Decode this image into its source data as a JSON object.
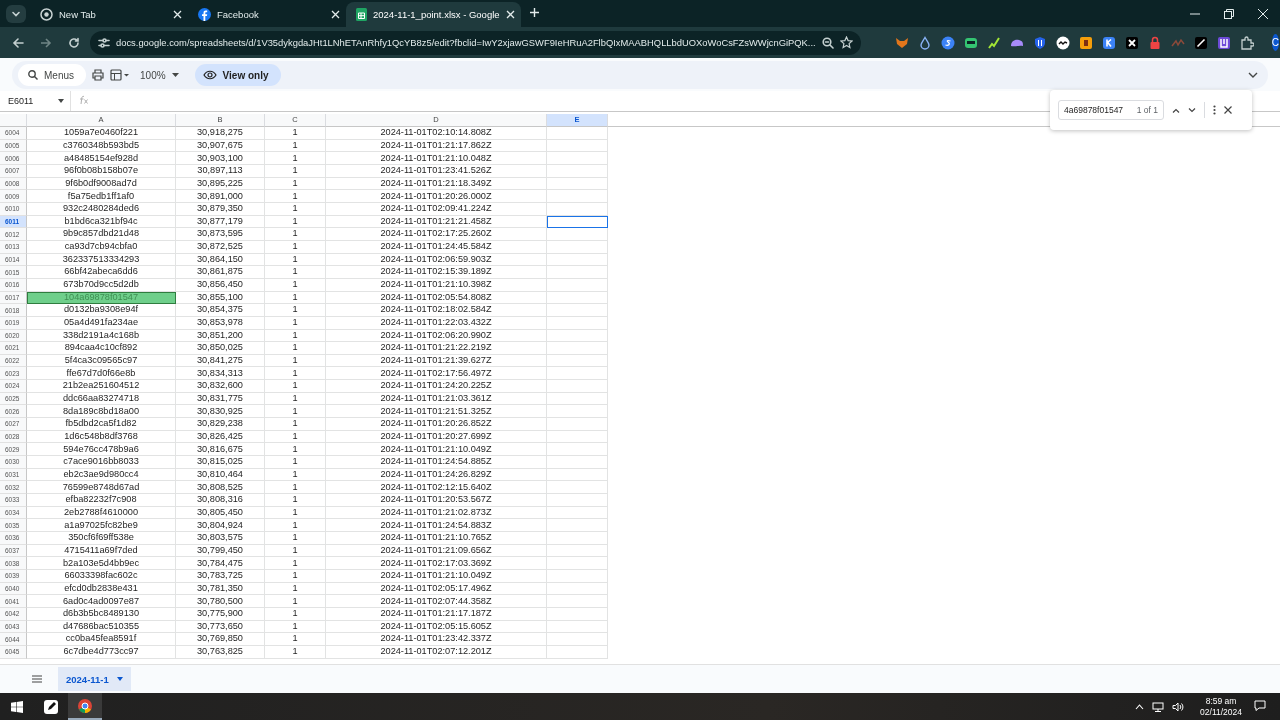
{
  "browser": {
    "tabs": [
      {
        "title": "New Tab",
        "kind": "chrome",
        "selected": false
      },
      {
        "title": "Facebook",
        "kind": "facebook",
        "selected": false
      },
      {
        "title": "2024-11-1_point.xlsx - Google",
        "kind": "sheets",
        "selected": true
      }
    ],
    "url": "docs.google.com/spreadsheets/d/1V35dykgdaJHt1LNhETAnRhfy1QcYB8z5/edit?fbclid=IwY2xjawGSWF9IeHRuA2FlbQIxMAABHQLLbdUOXoWoCsFZsWWjcnGiPQK...",
    "profile_initial": "C"
  },
  "toolbar": {
    "search_label": "Menus",
    "zoom": "100%",
    "mode": "View only"
  },
  "formula_bar": {
    "cell_ref": "E6011"
  },
  "columns": [
    {
      "label": "A",
      "selected": false
    },
    {
      "label": "B",
      "selected": false
    },
    {
      "label": "C",
      "selected": false
    },
    {
      "label": "D",
      "selected": false
    },
    {
      "label": "E",
      "selected": true
    }
  ],
  "rows": [
    {
      "number": "6004",
      "cells": [
        "1059a7e0460f221",
        "30,918,275",
        "1",
        "2024-11-01T02:10:14.808Z"
      ],
      "selected": false,
      "match": false
    },
    {
      "number": "6005",
      "cells": [
        "c3760348b593bd5",
        "30,907,675",
        "1",
        "2024-11-01T01:21:17.862Z"
      ],
      "selected": false,
      "match": false
    },
    {
      "number": "6006",
      "cells": [
        "a48485154ef928d",
        "30,903,100",
        "1",
        "2024-11-01T01:21:10.048Z"
      ],
      "selected": false,
      "match": false
    },
    {
      "number": "6007",
      "cells": [
        "96f0b08b158b07e",
        "30,897,113",
        "1",
        "2024-11-01T01:23:41.526Z"
      ],
      "selected": false,
      "match": false
    },
    {
      "number": "6008",
      "cells": [
        "9f6b0df9008ad7d",
        "30,895,225",
        "1",
        "2024-11-01T01:21:18.349Z"
      ],
      "selected": false,
      "match": false
    },
    {
      "number": "6009",
      "cells": [
        "f5a75edb1ff1af0",
        "30,891,000",
        "1",
        "2024-11-01T01:20:26.000Z"
      ],
      "selected": false,
      "match": false
    },
    {
      "number": "6010",
      "cells": [
        "932c2480284ded6",
        "30,879,350",
        "1",
        "2024-11-01T02:09:41.224Z"
      ],
      "selected": false,
      "match": false
    },
    {
      "number": "6011",
      "cells": [
        "b1bd6ca321bf94c",
        "30,877,179",
        "1",
        "2024-11-01T01:21:21.458Z"
      ],
      "selected": true,
      "match": false
    },
    {
      "number": "6012",
      "cells": [
        "9b9c857dbd21d48",
        "30,873,595",
        "1",
        "2024-11-01T02:17:25.260Z"
      ],
      "selected": false,
      "match": false
    },
    {
      "number": "6013",
      "cells": [
        "ca93d7cb94cbfa0",
        "30,872,525",
        "1",
        "2024-11-01T01:24:45.584Z"
      ],
      "selected": false,
      "match": false
    },
    {
      "number": "6014",
      "cells": [
        "362337513334293",
        "30,864,150",
        "1",
        "2024-11-01T02:06:59.903Z"
      ],
      "selected": false,
      "match": false
    },
    {
      "number": "6015",
      "cells": [
        "66bf42abeca6dd6",
        "30,861,875",
        "1",
        "2024-11-01T02:15:39.189Z"
      ],
      "selected": false,
      "match": false
    },
    {
      "number": "6016",
      "cells": [
        "673b70d9cc5d2db",
        "30,856,450",
        "1",
        "2024-11-01T01:21:10.398Z"
      ],
      "selected": false,
      "match": false
    },
    {
      "number": "6017",
      "cells": [
        "104a69878f01547",
        "30,855,100",
        "1",
        "2024-11-01T02:05:54.808Z"
      ],
      "selected": false,
      "match": true
    },
    {
      "number": "6018",
      "cells": [
        "d0132ba9308e94f",
        "30,854,375",
        "1",
        "2024-11-01T02:18:02.584Z"
      ],
      "selected": false,
      "match": false
    },
    {
      "number": "6019",
      "cells": [
        "05a4d491fa234ae",
        "30,853,978",
        "1",
        "2024-11-01T01:22:03.432Z"
      ],
      "selected": false,
      "match": false
    },
    {
      "number": "6020",
      "cells": [
        "338d2191a4c168b",
        "30,851,200",
        "1",
        "2024-11-01T02:06:20.990Z"
      ],
      "selected": false,
      "match": false
    },
    {
      "number": "6021",
      "cells": [
        "894caa4c10cf892",
        "30,850,025",
        "1",
        "2024-11-01T01:21:22.219Z"
      ],
      "selected": false,
      "match": false
    },
    {
      "number": "6022",
      "cells": [
        "5f4ca3c09565c97",
        "30,841,275",
        "1",
        "2024-11-01T01:21:39.627Z"
      ],
      "selected": false,
      "match": false
    },
    {
      "number": "6023",
      "cells": [
        "ffe67d7d0f66e8b",
        "30,834,313",
        "1",
        "2024-11-01T02:17:56.497Z"
      ],
      "selected": false,
      "match": false
    },
    {
      "number": "6024",
      "cells": [
        "21b2ea251604512",
        "30,832,600",
        "1",
        "2024-11-01T01:24:20.225Z"
      ],
      "selected": false,
      "match": false
    },
    {
      "number": "6025",
      "cells": [
        "ddc66aa83274718",
        "30,831,775",
        "1",
        "2024-11-01T01:21:03.361Z"
      ],
      "selected": false,
      "match": false
    },
    {
      "number": "6026",
      "cells": [
        "8da189c8bd18a00",
        "30,830,925",
        "1",
        "2024-11-01T01:21:51.325Z"
      ],
      "selected": false,
      "match": false
    },
    {
      "number": "6027",
      "cells": [
        "fb5dbd2ca5f1d82",
        "30,829,238",
        "1",
        "2024-11-01T01:20:26.852Z"
      ],
      "selected": false,
      "match": false
    },
    {
      "number": "6028",
      "cells": [
        "1d6c548b8df3768",
        "30,826,425",
        "1",
        "2024-11-01T01:20:27.699Z"
      ],
      "selected": false,
      "match": false
    },
    {
      "number": "6029",
      "cells": [
        "594e76cc478b9a6",
        "30,816,675",
        "1",
        "2024-11-01T01:21:10.049Z"
      ],
      "selected": false,
      "match": false
    },
    {
      "number": "6030",
      "cells": [
        "c7ace9016bb8033",
        "30,815,025",
        "1",
        "2024-11-01T01:24:54.885Z"
      ],
      "selected": false,
      "match": false
    },
    {
      "number": "6031",
      "cells": [
        "eb2c3ae9d980cc4",
        "30,810,464",
        "1",
        "2024-11-01T01:24:26.829Z"
      ],
      "selected": false,
      "match": false
    },
    {
      "number": "6032",
      "cells": [
        "76599e8748d67ad",
        "30,808,525",
        "1",
        "2024-11-01T02:12:15.640Z"
      ],
      "selected": false,
      "match": false
    },
    {
      "number": "6033",
      "cells": [
        "efba82232f7c908",
        "30,808,316",
        "1",
        "2024-11-01T01:20:53.567Z"
      ],
      "selected": false,
      "match": false
    },
    {
      "number": "6034",
      "cells": [
        "2eb2788f4610000",
        "30,805,450",
        "1",
        "2024-11-01T01:21:02.873Z"
      ],
      "selected": false,
      "match": false
    },
    {
      "number": "6035",
      "cells": [
        "a1a97025fc82be9",
        "30,804,924",
        "1",
        "2024-11-01T01:24:54.883Z"
      ],
      "selected": false,
      "match": false
    },
    {
      "number": "6036",
      "cells": [
        "350cf6f69ff538e",
        "30,803,575",
        "1",
        "2024-11-01T01:21:10.765Z"
      ],
      "selected": false,
      "match": false
    },
    {
      "number": "6037",
      "cells": [
        "4715411a69f7ded",
        "30,799,450",
        "1",
        "2024-11-01T01:21:09.656Z"
      ],
      "selected": false,
      "match": false
    },
    {
      "number": "6038",
      "cells": [
        "b2a103e5d4bb9ec",
        "30,784,475",
        "1",
        "2024-11-01T02:17:03.369Z"
      ],
      "selected": false,
      "match": false
    },
    {
      "number": "6039",
      "cells": [
        "66033398fac602c",
        "30,783,725",
        "1",
        "2024-11-01T01:21:10.049Z"
      ],
      "selected": false,
      "match": false
    },
    {
      "number": "6040",
      "cells": [
        "efcd0db2838e431",
        "30,781,350",
        "1",
        "2024-11-01T02:05:17.496Z"
      ],
      "selected": false,
      "match": false
    },
    {
      "number": "6041",
      "cells": [
        "6ad0c4ad0097e87",
        "30,780,500",
        "1",
        "2024-11-01T02:07:44.358Z"
      ],
      "selected": false,
      "match": false
    },
    {
      "number": "6042",
      "cells": [
        "d6b3b5bc8489130",
        "30,775,900",
        "1",
        "2024-11-01T01:21:17.187Z"
      ],
      "selected": false,
      "match": false
    },
    {
      "number": "6043",
      "cells": [
        "d47686bac510355",
        "30,773,650",
        "1",
        "2024-11-01T02:05:15.605Z"
      ],
      "selected": false,
      "match": false
    },
    {
      "number": "6044",
      "cells": [
        "cc0ba45fea8591f",
        "30,769,850",
        "1",
        "2024-11-01T01:23:42.337Z"
      ],
      "selected": false,
      "match": false
    },
    {
      "number": "6045",
      "cells": [
        "6c7dbe4d773cc97",
        "30,763,825",
        "1",
        "2024-11-01T02:07:12.201Z"
      ],
      "selected": false,
      "match": false
    }
  ],
  "find": {
    "query": "4a69878f01547",
    "count": "1 of 1"
  },
  "sheet_tabs": [
    {
      "label": "2024-11-1",
      "selected": true
    }
  ],
  "taskbar": {
    "time": "8:59 am",
    "date": "02/11/2024"
  }
}
